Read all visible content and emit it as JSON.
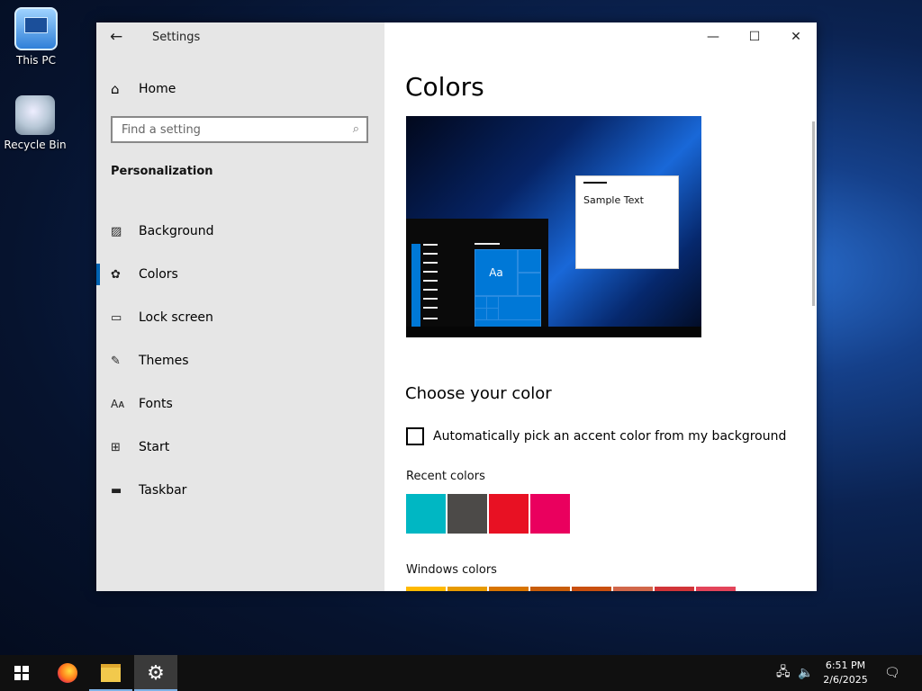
{
  "desktop": {
    "icons": [
      {
        "label": "This PC",
        "icon": "this-pc-icon"
      },
      {
        "label": "Recycle Bin",
        "icon": "recycle-bin-icon"
      }
    ]
  },
  "window": {
    "title": "Settings",
    "controls": {
      "minimize": "—",
      "maximize": "☐",
      "close": "✕"
    }
  },
  "sidebar": {
    "home_label": "Home",
    "search_placeholder": "Find a setting",
    "section": "Personalization",
    "items": [
      {
        "label": "Background",
        "icon": "picture-icon"
      },
      {
        "label": "Colors",
        "icon": "palette-icon",
        "active": true
      },
      {
        "label": "Lock screen",
        "icon": "lock-screen-icon"
      },
      {
        "label": "Themes",
        "icon": "themes-icon"
      },
      {
        "label": "Fonts",
        "icon": "fonts-icon"
      },
      {
        "label": "Start",
        "icon": "start-icon"
      },
      {
        "label": "Taskbar",
        "icon": "taskbar-icon"
      }
    ]
  },
  "main": {
    "title": "Colors",
    "preview": {
      "sample_text": "Sample Text",
      "tile_label": "Aa"
    },
    "choose_heading": "Choose your color",
    "auto_accent_label": "Automatically pick an accent color from my background",
    "auto_accent_checked": false,
    "recent_label": "Recent colors",
    "recent_colors": [
      "#00b7c3",
      "#4c4a48",
      "#e81123",
      "#ea005e"
    ],
    "windows_label": "Windows colors",
    "windows_colors": [
      "#ffb900",
      "#e79a00",
      "#d87400",
      "#c85d0a",
      "#c94f0f",
      "#d1674a",
      "#d13438",
      "#e3445a"
    ]
  },
  "taskbar": {
    "time": "6:51 PM",
    "date": "2/6/2025"
  },
  "accent": "#0063b1"
}
